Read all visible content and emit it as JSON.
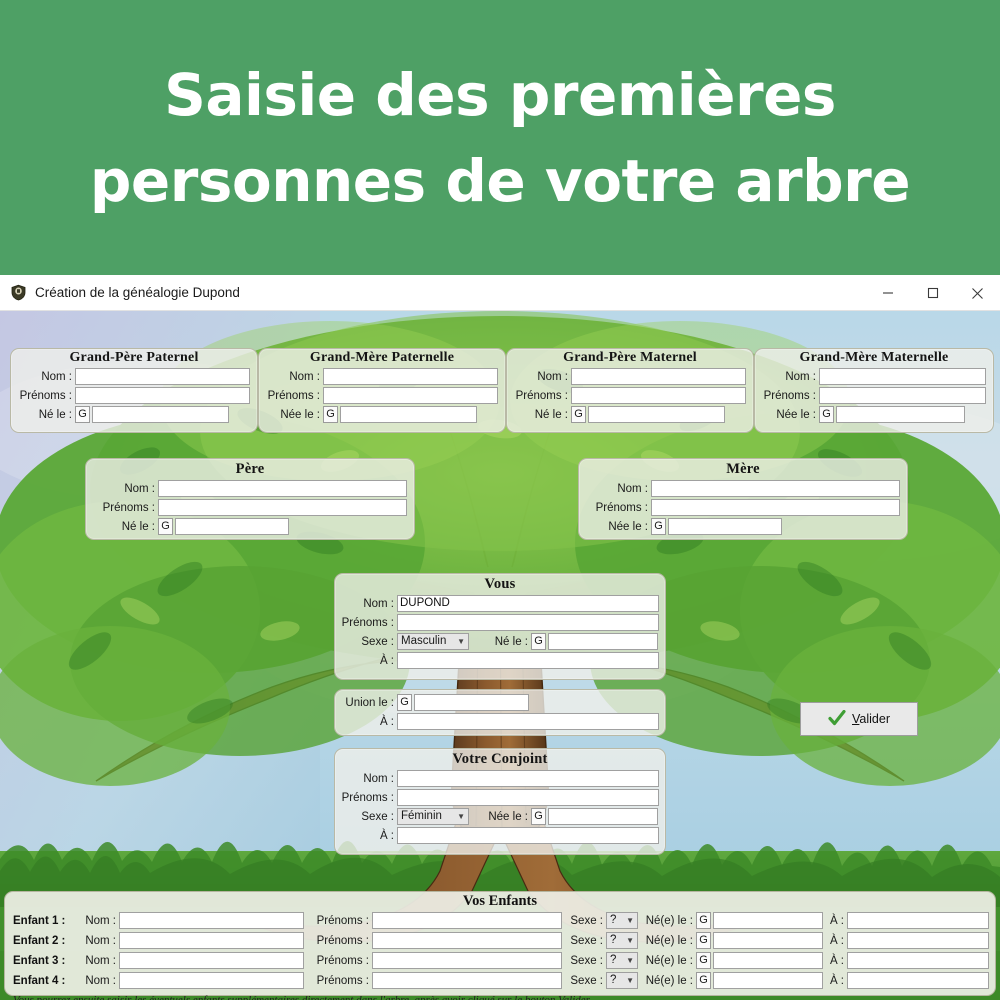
{
  "banner": {
    "line1": "Saisie des premières",
    "line2": "personnes de votre arbre",
    "bg_color": "#4ea065",
    "text_color": "#ffffff"
  },
  "window": {
    "title": "Création de la généalogie Dupond",
    "icon": "shield-icon",
    "minimize": "—",
    "maximize": "▢",
    "close": "✕"
  },
  "labels": {
    "nom": "Nom :",
    "prenoms": "Prénoms :",
    "ne_le": "Né le :",
    "nee_le": "Née le :",
    "sexe": "Sexe :",
    "a": "À :",
    "union_le": "Union le :",
    "nee_le_enfant": "Né(e) le :",
    "calendar_button": "G"
  },
  "grandparents": [
    {
      "title": "Grand-Père Paternel",
      "nom": "",
      "prenoms": "",
      "birth_label": "Né le :",
      "birth_date": ""
    },
    {
      "title": "Grand-Mère Paternelle",
      "nom": "",
      "prenoms": "",
      "birth_label": "Née le :",
      "birth_date": ""
    },
    {
      "title": "Grand-Père Maternel",
      "nom": "",
      "prenoms": "",
      "birth_label": "Né le :",
      "birth_date": ""
    },
    {
      "title": "Grand-Mère Maternelle",
      "nom": "",
      "prenoms": "",
      "birth_label": "Née le :",
      "birth_date": ""
    }
  ],
  "parents": [
    {
      "title": "Père",
      "nom": "",
      "prenoms": "",
      "birth_label": "Né le :",
      "birth_date": ""
    },
    {
      "title": "Mère",
      "nom": "",
      "prenoms": "",
      "birth_label": "Née le :",
      "birth_date": ""
    }
  ],
  "you": {
    "title": "Vous",
    "nom": "DUPOND",
    "prenoms": "",
    "sexe_label": "Sexe :",
    "sexe_value": "Masculin",
    "sexe_options": [
      "Masculin",
      "Féminin",
      "?"
    ],
    "birth_label": "Né le :",
    "birth_date": "",
    "birth_place_label": "À :",
    "birth_place": ""
  },
  "union": {
    "label": "Union le :",
    "date": "",
    "place_label": "À :",
    "place": ""
  },
  "spouse": {
    "title": "Votre Conjoint",
    "nom": "",
    "prenoms": "",
    "sexe_label": "Sexe :",
    "sexe_value": "Féminin",
    "sexe_options": [
      "Masculin",
      "Féminin",
      "?"
    ],
    "birth_label": "Née le :",
    "birth_date": "",
    "birth_place_label": "À :",
    "birth_place": ""
  },
  "validate": {
    "label_prefix": "V",
    "label_rest": "alider",
    "icon": "green-check-icon",
    "icon_color": "#4aa540"
  },
  "children_section": {
    "title": "Vos Enfants",
    "nom_label": "Nom :",
    "prenoms_label": "Prénoms :",
    "sexe_label": "Sexe :",
    "birth_label": "Né(e) le :",
    "place_label": "À :",
    "calendar_button": "G",
    "rows": [
      {
        "name": "Enfant 1 :",
        "nom": "",
        "prenoms": "",
        "sexe": "?",
        "birth": "",
        "place": ""
      },
      {
        "name": "Enfant 2 :",
        "nom": "",
        "prenoms": "",
        "sexe": "?",
        "birth": "",
        "place": ""
      },
      {
        "name": "Enfant 3 :",
        "nom": "",
        "prenoms": "",
        "sexe": "?",
        "birth": "",
        "place": ""
      },
      {
        "name": "Enfant 4 :",
        "nom": "",
        "prenoms": "",
        "sexe": "?",
        "birth": "",
        "place": ""
      }
    ],
    "footer_note": "Vous pourrez ensuite saisir les éventuels enfants supplémentaires directement dans l'arbre, après avoir cliqué sur le bouton Valider ..."
  }
}
